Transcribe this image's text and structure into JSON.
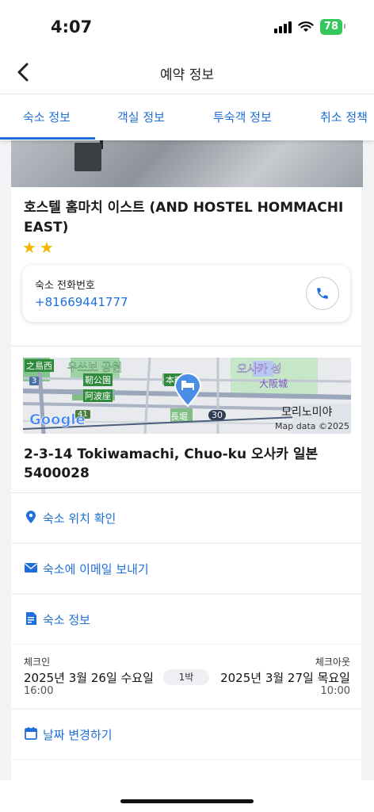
{
  "status_bar": {
    "time": "4:07",
    "battery": "78"
  },
  "header": {
    "title": "예약 정보"
  },
  "tabs": [
    {
      "label": "숙소 정보"
    },
    {
      "label": "객실 정보"
    },
    {
      "label": "투숙객 정보"
    },
    {
      "label": "취소 정책"
    }
  ],
  "hotel": {
    "name": "호스텔 홈마치 이스트 (AND HOSTEL HOMMACHI EAST)",
    "star_rating": 2,
    "phone_label": "숙소 전화번호",
    "phone_number": "+81669441777"
  },
  "map": {
    "labels": [
      "之島西",
      "우쓰보 공원",
      "靭公園",
      "阿波座",
      "本町",
      "오사카 성",
      "大阪城",
      "모리노미야",
      "長堀"
    ],
    "route_numbers": [
      "3",
      "41",
      "30"
    ],
    "google_logo": "Google",
    "attribution": "Map data ©2025"
  },
  "address": "2-3-14 Tokiwamachi, Chuo-ku 오사카 일본 5400028",
  "actions": [
    {
      "label": "숙소 위치 확인",
      "icon": "location-pin-icon"
    },
    {
      "label": "숙소에 이메일 보내기",
      "icon": "mail-icon"
    },
    {
      "label": "숙소 정보",
      "icon": "pdf-document-icon"
    }
  ],
  "stay": {
    "checkin_label": "체크인",
    "checkout_label": "체크아웃",
    "checkin_date": "2025년 3월 26일 수요일",
    "checkout_date": "2025년 3월 27일 목요일",
    "checkin_time": "16:00",
    "checkout_time": "10:00",
    "nights": "1박"
  },
  "change_dates": {
    "label": "날짜 변경하기",
    "icon": "calendar-icon"
  },
  "colors": {
    "accent": "#1e6fd9",
    "star": "#f5b800",
    "battery": "#34c759"
  }
}
